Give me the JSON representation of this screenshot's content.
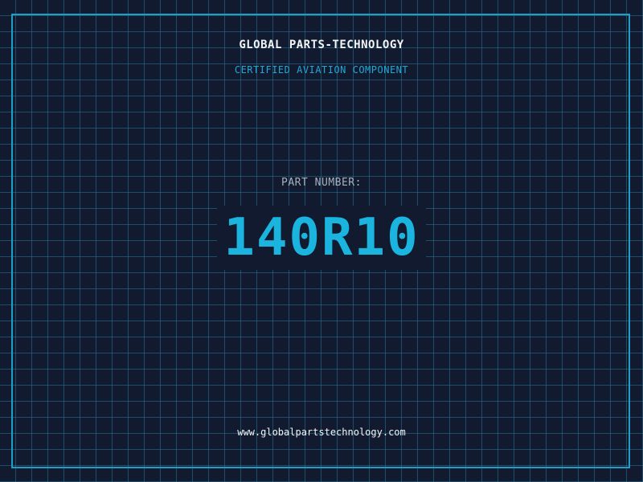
{
  "header": {
    "company": "GLOBAL PARTS-TECHNOLOGY",
    "tagline": "CERTIFIED AVIATION COMPONENT"
  },
  "part": {
    "label": "PART NUMBER:",
    "number": "140R10"
  },
  "footer": {
    "website": "www.globalpartstechnology.com"
  },
  "colors": {
    "background": "#111a2f",
    "grid": "#26788f",
    "frame": "#1f9ec8",
    "accent": "#1ab4de",
    "text": "#f2f4f7",
    "muted": "#a7b0bd"
  }
}
